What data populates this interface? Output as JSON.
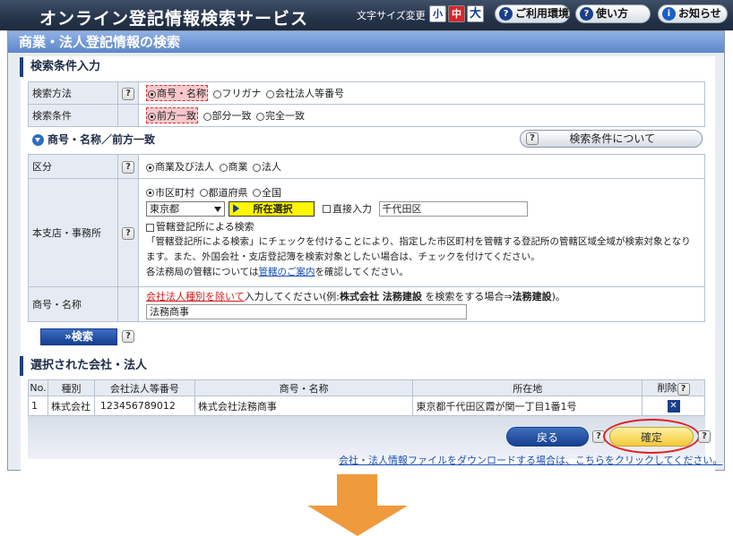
{
  "header": {
    "title": "オンライン登記情報検索サービス",
    "font_size_label": "文字サイズ変更",
    "font_small": "小",
    "font_medium": "中",
    "font_large": "大",
    "env_button": "ご利用環境",
    "usage_button": "使い方",
    "notice_button": "お知らせ"
  },
  "panel": {
    "title": "商業・法人登記情報の検索"
  },
  "conditions": {
    "heading": "検索条件入力",
    "method_label": "検索方法",
    "method_options": [
      "商号・名称",
      "フリガナ",
      "会社法人等番号"
    ],
    "condition_label": "検索条件",
    "condition_options": [
      "前方一致",
      "部分一致",
      "完全一致"
    ]
  },
  "sub_section": {
    "title": "商号・名称／前方一致",
    "about_button": "検索条件について"
  },
  "form": {
    "category_label": "区分",
    "category_options": [
      "商業及び法人",
      "商業",
      "法人"
    ],
    "office_label": "本支店・事務所",
    "scope_options": [
      "市区町村",
      "都道府県",
      "全国"
    ],
    "prefecture": "東京都",
    "locate_button": "所在選択",
    "direct_input_label": "直接入力",
    "city_value": "千代田区",
    "jurisdiction_check": "管轄登記所による検索",
    "note_line1": "「管轄登記所による検索」にチェックを付けることにより、指定した市区町村を管轄する登記所の管轄区域全域が検索対象となり",
    "note_line2": "ます。また、外国会社・支店登記簿を検索対象としたい場合は、チェックを付けてください。",
    "note_line3_prefix": "各法務局の管轄については",
    "note_line3_link": "管轄のご案内",
    "note_line3_suffix": "を確認してください。",
    "name_label": "商号・名称",
    "name_hint_link": "会社法人種別を除いて",
    "name_hint_text": "入力してください(例:",
    "name_hint_bold1": "株式会社 法務建設",
    "name_hint_text2": "を検索をする場合⇒",
    "name_hint_bold2": "法務建設",
    "name_hint_end": ")。",
    "name_value": "法務商事"
  },
  "search_button": "»検索",
  "selected": {
    "heading": "選択された会社・法人",
    "columns": [
      "No.",
      "種別",
      "会社法人等番号",
      "商号・名称",
      "所在地",
      "削除"
    ],
    "rows": [
      {
        "no": "1",
        "type": "株式会社",
        "number": "123456789012",
        "name": "株式会社法務商事",
        "address": "東京都千代田区霞が関一丁目1番1号"
      }
    ]
  },
  "actions": {
    "back": "戻る",
    "confirm": "確定",
    "download_link": "会社・法人情報ファイルをダウンロードする場合は、こちらをクリックしてください。"
  },
  "colors": {
    "arrow": "#f09a3e",
    "highlight_ring": "#e02020",
    "header_bg": "#26344a"
  }
}
